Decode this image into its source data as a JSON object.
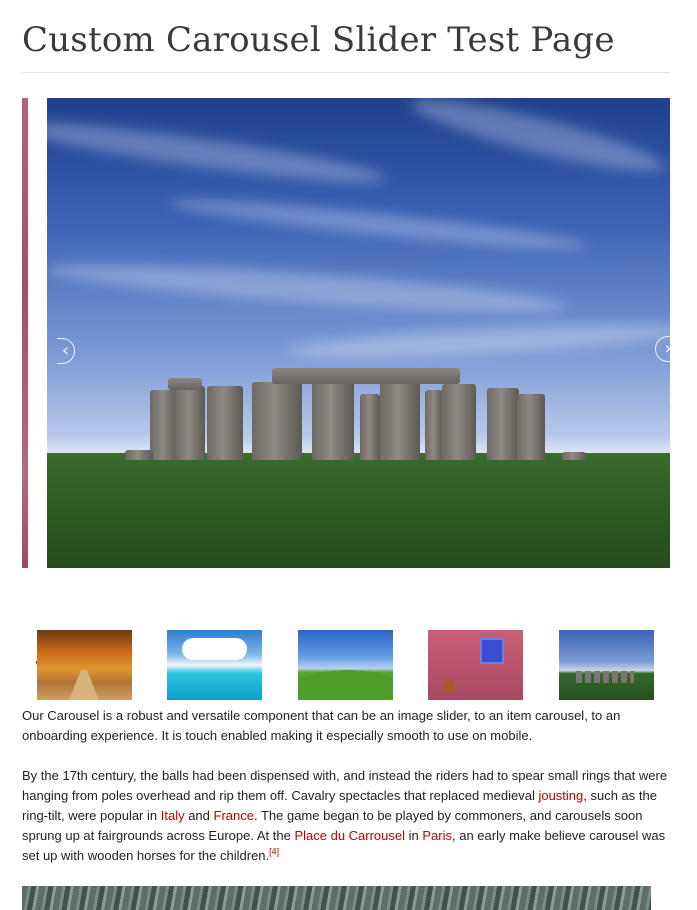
{
  "page": {
    "title": "Custom Carousel Slider Test Page"
  },
  "carousel": {
    "prev_arrow": "‹",
    "next_arrow": "›",
    "active_slide": "Stonehenge",
    "thumbnails": [
      {
        "subject": "autumn tree-lined road"
      },
      {
        "subject": "tropical island and clouds"
      },
      {
        "subject": "green hill and blue sky"
      },
      {
        "subject": "pink wall with blue window"
      },
      {
        "subject": "Stonehenge"
      }
    ]
  },
  "content": {
    "p1": "Our Carousel is a robust and versatile component that can be an image slider, to an item carousel, to an onboarding experience. It is touch enabled making it especially smooth to use on mobile.",
    "p2_a": "By the 17th century, the balls had been dispensed with, and instead the riders had to spear small rings that were hanging from poles overhead and rip them off. Cavalry spectacles that replaced medieval ",
    "p2_link_jousting": "jousting",
    "p2_b": ", such as the ring-tilt, were popular in ",
    "p2_link_italy": "Italy",
    "p2_c": " and ",
    "p2_link_france": "France",
    "p2_d": ". The game began to be played by commoners, and carousels soon sprung up at fairgrounds across Europe. At the ",
    "p2_link_place": "Place du Carrousel",
    "p2_e": " in ",
    "p2_link_paris": "Paris",
    "p2_f": ", an early make believe carousel was set up with wooden horses for the children.",
    "p2_ref": "[4]"
  },
  "colors": {
    "link": "#c00000",
    "title": "#3a3a3a",
    "prev_slide_edge": "#a24e6b"
  },
  "icons": {
    "prev": "chevron-left-icon",
    "next": "chevron-right-icon"
  }
}
